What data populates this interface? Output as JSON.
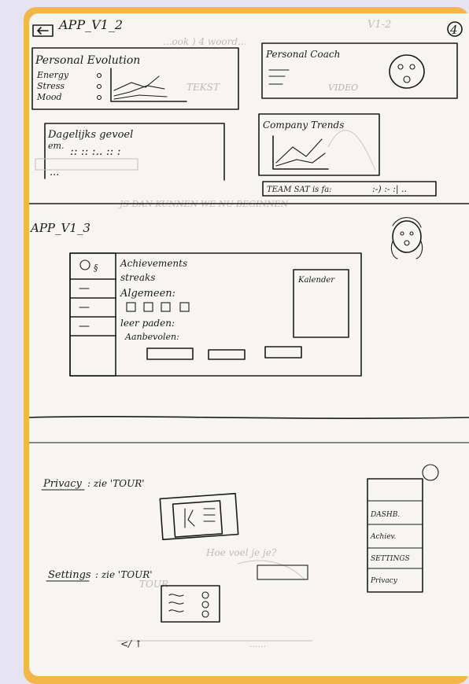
{
  "sheet": {
    "page_number": "4",
    "colors": {
      "frame": "#f2b649",
      "paper": "#f6f5f1",
      "ink": "#1b1b1b",
      "bleed": "#b8b6b0"
    }
  },
  "screen1": {
    "back_icon": "back-arrow-icon",
    "title": "APP_V1_2",
    "personal_evolution": {
      "title": "Personal Evolution",
      "rows": [
        "Energy",
        "Stress",
        "Mood"
      ]
    },
    "personal_coach": {
      "title": "Personal Coach",
      "video_label": "VIDEO"
    },
    "dagelijks": {
      "title": "Dagelijks gevoel",
      "sub": "em."
    },
    "company_trends": {
      "title": "Company Trends"
    },
    "team_sat": {
      "label": "TEAM SAT is fa:"
    }
  },
  "screen2": {
    "title": "APP_V1_3",
    "header": {
      "achievements": "Achievements",
      "streaks": "streaks"
    },
    "algemeen": "Algemeen:",
    "leerpaden": "leer paden:",
    "aanbevolen": "Aanbevolen:",
    "kalender": "Kalender"
  },
  "screen3": {
    "privacy": {
      "label": "Privacy",
      "tour": ": zie 'TOUR'"
    },
    "settings": {
      "label": "Settings",
      "tour": ": zie 'TOUR'"
    },
    "menu_right": [
      "DASHB.",
      "Achiev.",
      "SETTINGS",
      "Privacy"
    ]
  }
}
